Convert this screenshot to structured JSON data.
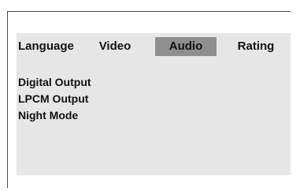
{
  "tabs": [
    {
      "label": "Language",
      "active": false
    },
    {
      "label": "Video",
      "active": false
    },
    {
      "label": "Audio",
      "active": true
    },
    {
      "label": "Rating",
      "active": false
    }
  ],
  "menu": {
    "items": [
      {
        "label": "Digital Output"
      },
      {
        "label": "LPCM Output"
      },
      {
        "label": "Night Mode"
      }
    ]
  },
  "colors": {
    "panel_background": "#e6e6e6",
    "active_tab": "#8f8f8f",
    "text": "#111111",
    "frame_border": "#4a4a4a"
  }
}
